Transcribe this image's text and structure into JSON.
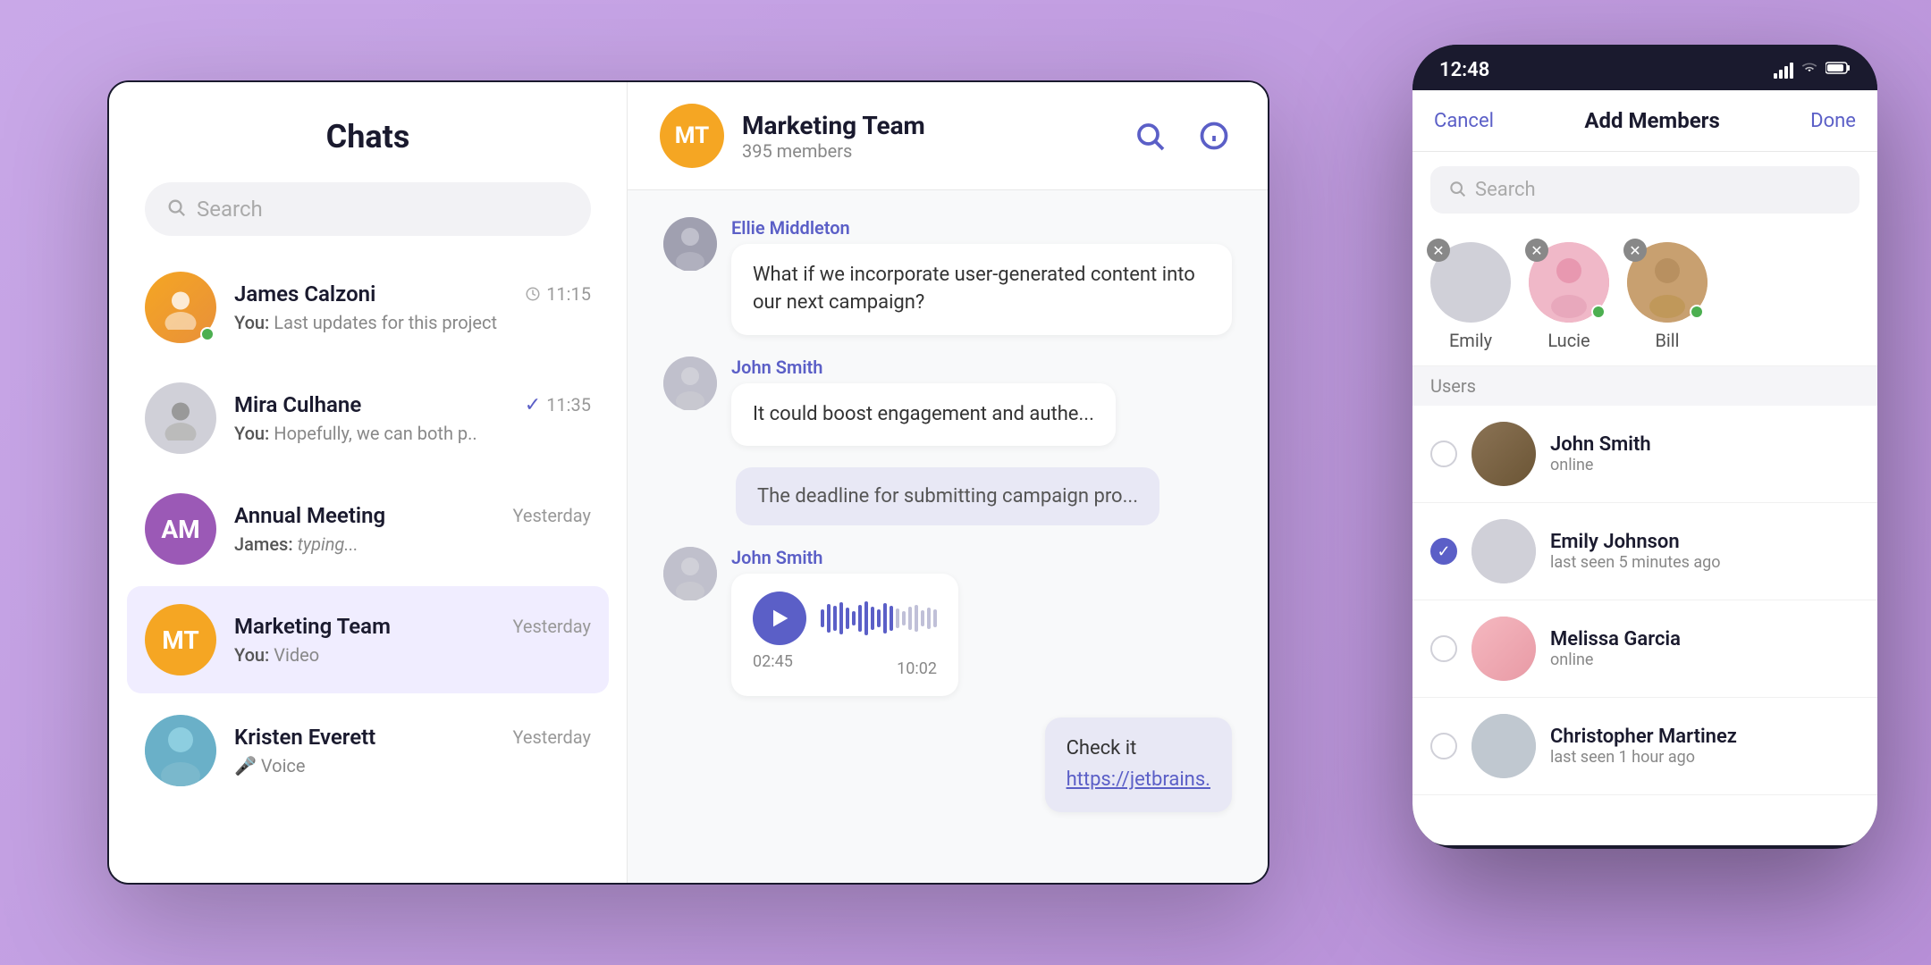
{
  "background": {
    "color": "#c9a8e8"
  },
  "desktop_window": {
    "sidebar": {
      "title": "Chats",
      "search_placeholder": "Search",
      "chats": [
        {
          "id": "james-calzoni",
          "name": "James Calzoni",
          "time": "11:15",
          "preview_sender": "You:",
          "preview_text": "Last updates for this project",
          "has_online": true,
          "avatar_type": "image",
          "avatar_color": "#f5a623"
        },
        {
          "id": "mira-culhane",
          "name": "Mira Culhane",
          "time": "11:35",
          "preview_sender": "You:",
          "preview_text": "Hopefully, we can both p..",
          "has_online": false,
          "has_tick": true,
          "avatar_type": "placeholder",
          "avatar_color": "#d0d0d8"
        },
        {
          "id": "annual-meeting",
          "name": "Annual Meeting",
          "time": "Yesterday",
          "preview_sender": "James:",
          "preview_text": "typing...",
          "preview_italic": true,
          "avatar_type": "initials",
          "avatar_initials": "AM",
          "avatar_color": "#9b59b6"
        },
        {
          "id": "marketing-team",
          "name": "Marketing Team",
          "time": "Yesterday",
          "preview_sender": "You:",
          "preview_text": "Video",
          "is_active": true,
          "avatar_type": "initials",
          "avatar_initials": "MT",
          "avatar_color": "#f5a623"
        },
        {
          "id": "kristen-everett",
          "name": "Kristen Everett",
          "time": "Yesterday",
          "preview_icon": "mic",
          "preview_text": "Voice",
          "avatar_type": "image",
          "avatar_color": "#6ab0c8"
        }
      ]
    },
    "main_chat": {
      "header": {
        "avatar_initials": "MT",
        "avatar_color": "#f5a623",
        "name": "Marketing Team",
        "members": "395 members"
      },
      "messages": [
        {
          "id": "msg1",
          "sender": "Ellie Middleton",
          "sender_color": "#5b5fc7",
          "text": "What if we incorporate user-generated content into our next campaign?",
          "avatar_type": "image"
        },
        {
          "id": "msg2",
          "sender": "John Smith",
          "sender_color": "#5b5fc7",
          "text": "It could boost engagement and authe...",
          "avatar_type": "placeholder"
        },
        {
          "id": "msg3",
          "type": "system",
          "text": "The deadline for submitting campaign pro..."
        },
        {
          "id": "msg4",
          "sender": "John Smith",
          "sender_color": "#5b5fc7",
          "type": "voice",
          "duration": "02:45",
          "time": "10:02",
          "avatar_type": "placeholder"
        },
        {
          "id": "msg5",
          "type": "link",
          "text": "Check it",
          "link": "https://jetbrains."
        }
      ]
    }
  },
  "mobile_phone": {
    "status_bar": {
      "time": "12:48"
    },
    "nav": {
      "cancel_label": "Cancel",
      "title": "Add Members",
      "done_label": "Done"
    },
    "search_placeholder": "Search",
    "selected_members": [
      {
        "id": "emily",
        "name": "Emily",
        "has_online": false
      },
      {
        "id": "lucie",
        "name": "Lucie",
        "has_online": true
      },
      {
        "id": "bill",
        "name": "Bill",
        "has_online": true
      }
    ],
    "users_section_label": "Users",
    "users": [
      {
        "id": "john-smith",
        "name": "John Smith",
        "status": "online",
        "selected": false
      },
      {
        "id": "emily-johnson",
        "name": "Emily Johnson",
        "status": "last seen 5 minutes ago",
        "selected": true
      },
      {
        "id": "melissa-garcia",
        "name": "Melissa Garcia",
        "status": "online",
        "selected": false
      },
      {
        "id": "christopher-martinez",
        "name": "Christopher Martinez",
        "status": "last seen 1 hour ago",
        "selected": false
      }
    ]
  }
}
